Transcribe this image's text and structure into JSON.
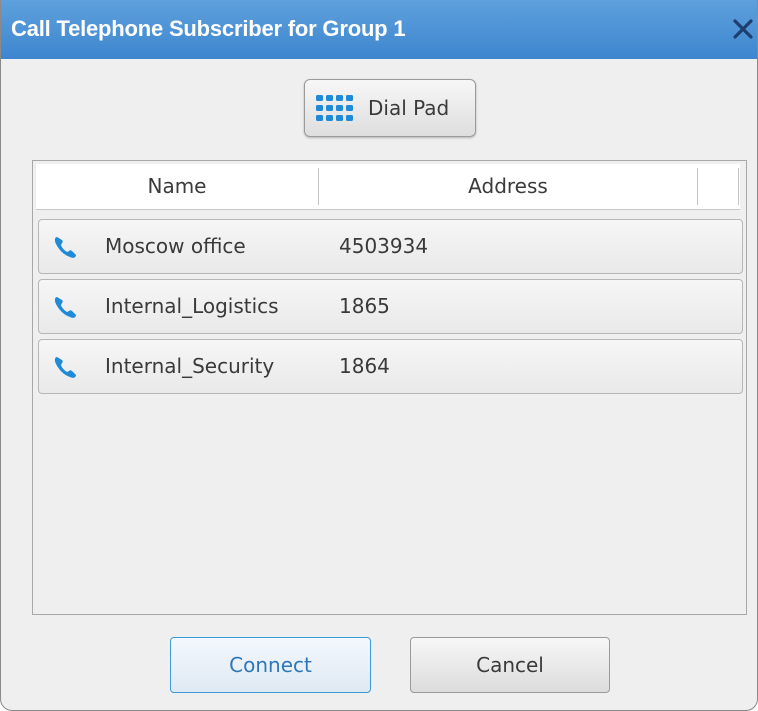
{
  "window": {
    "title": "Call Telephone Subscriber for Group 1",
    "close_icon": "close-icon",
    "title_bar_color": "#4a90d6"
  },
  "toolbar": {
    "dial_pad_label": "Dial Pad",
    "dial_pad_icon": "keypad-icon",
    "icon_color": "#1f8ad8"
  },
  "table": {
    "columns": [
      "Name",
      "Address"
    ],
    "rows": [
      {
        "name": "Moscow office",
        "address": "4503934",
        "icon": "phone-icon"
      },
      {
        "name": "Internal_Logistics",
        "address": "1865",
        "icon": "phone-icon"
      },
      {
        "name": "Internal_Security",
        "address": "1864",
        "icon": "phone-icon"
      }
    ]
  },
  "buttons": {
    "connect_label": "Connect",
    "cancel_label": "Cancel",
    "accent_color": "#3d9ad8"
  }
}
